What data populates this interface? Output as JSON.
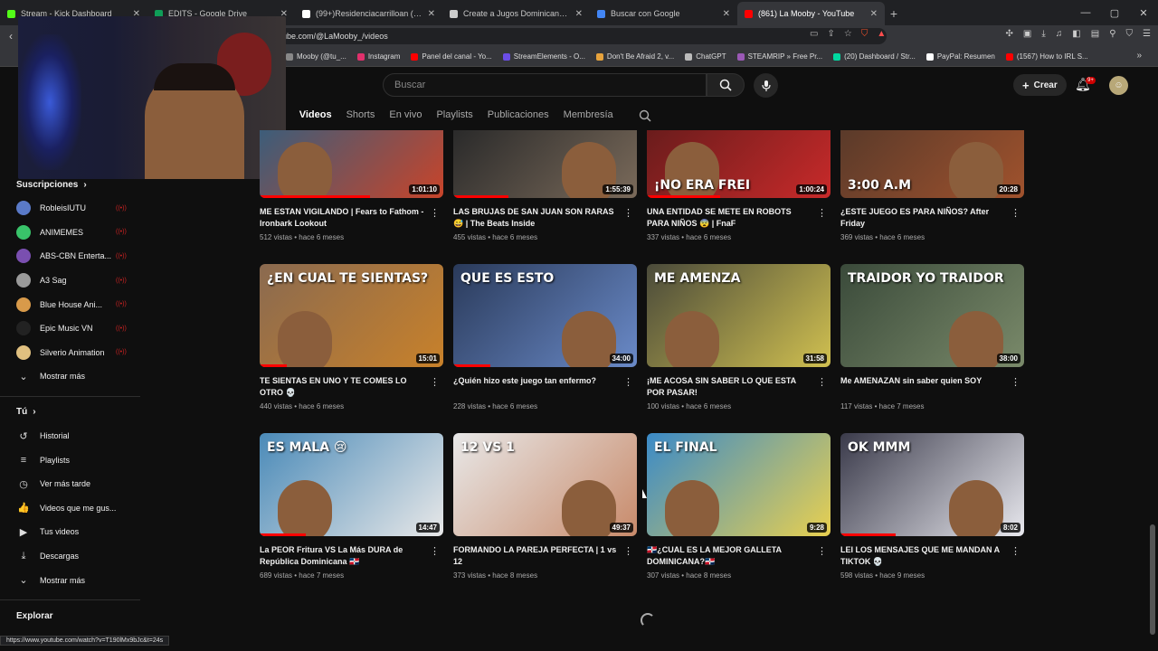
{
  "browser": {
    "tabs": [
      {
        "label": "Stream - Kick Dashboard",
        "color": "#53fc18"
      },
      {
        "label": "EDITS - Google Drive",
        "color": "#0f9d58"
      },
      {
        "label": "(99+)Residenciacarrilloan (@residenc",
        "color": "#ffffff"
      },
      {
        "label": "Create a Jugos Dominicanos Tier List",
        "color": "#cccccc"
      },
      {
        "label": "Buscar con Google",
        "color": "#4285f4"
      },
      {
        "label": "(861) La Mooby - YouTube",
        "color": "#ff0000",
        "active": true
      }
    ],
    "new_tab": "+",
    "address": "ube.com/@LaMooby_/videos",
    "bookmarks": [
      {
        "label": "Mooby (@tu_...",
        "color": "#888888"
      },
      {
        "label": "Instagram",
        "color": "#e1306c"
      },
      {
        "label": "Panel del canal - Yo...",
        "color": "#ff0000"
      },
      {
        "label": "StreamElements - O...",
        "color": "#6b4de6"
      },
      {
        "label": "Don't Be Afraid 2, v...",
        "color": "#e6a23c"
      },
      {
        "label": "ChatGPT",
        "color": "#bbbbbb"
      },
      {
        "label": "STEAMRIP » Free Pr...",
        "color": "#9b59b6"
      },
      {
        "label": "(20) Dashboard / Str...",
        "color": "#00d8a0"
      },
      {
        "label": "PayPal: Resumen",
        "color": "#ffffff"
      },
      {
        "label": "(1567) How to IRL S...",
        "color": "#ff0000"
      }
    ],
    "status_url": "https://www.youtube.com/watch?v=T190lMx9bJc&t=24s"
  },
  "youtube": {
    "search_placeholder": "Buscar",
    "create_label": "Crear",
    "notifications": "9+",
    "channel_tabs": [
      {
        "label": "pal",
        "active": false
      },
      {
        "label": "Videos",
        "active": true
      },
      {
        "label": "Shorts",
        "active": false
      },
      {
        "label": "En vivo",
        "active": false
      },
      {
        "label": "Playlists",
        "active": false
      },
      {
        "label": "Publicaciones",
        "active": false
      },
      {
        "label": "Membresía",
        "active": false
      }
    ]
  },
  "sidebar": {
    "subscriptions_title": "Suscripciones",
    "subscriptions": [
      {
        "label": "RobleisIUTU",
        "color": "#5a7ac8"
      },
      {
        "label": "ANIMEMES",
        "color": "#39c36a"
      },
      {
        "label": "ABS-CBN Enterta...",
        "color": "#7a4fb0"
      },
      {
        "label": "A3 Sag",
        "color": "#9a9a9a"
      },
      {
        "label": "Blue House Ani...",
        "color": "#d89a4a"
      },
      {
        "label": "Epic Music VN",
        "color": "#222222"
      },
      {
        "label": "Silverio Animation",
        "color": "#e0c080"
      }
    ],
    "show_more_1": "Mostrar más",
    "you_title": "Tú",
    "you_items": [
      {
        "label": "Historial",
        "icon": "history-icon",
        "glyph": "↺"
      },
      {
        "label": "Playlists",
        "icon": "playlist-icon",
        "glyph": "≡"
      },
      {
        "label": "Ver más tarde",
        "icon": "clock-icon",
        "glyph": "◷"
      },
      {
        "label": "Videos que me gus...",
        "icon": "thumb-up-icon",
        "glyph": "👍"
      },
      {
        "label": "Tus videos",
        "icon": "your-videos-icon",
        "glyph": "▶"
      },
      {
        "label": "Descargas",
        "icon": "download-icon",
        "glyph": "⤓"
      }
    ],
    "show_more_2": "Mostrar más",
    "explore_title": "Explorar"
  },
  "videos": [
    {
      "title": "ME ESTAN VIGILANDO | Fears to Fathom - Ironbark Lookout",
      "meta": "512 vistas • hace 6 meses",
      "duration": "1:01:10",
      "bg": "#3c5d7a",
      "accent": "#c8442a",
      "progress": 0.6
    },
    {
      "title": "LAS BRUJAS DE SAN JUAN SON RARAS 😅 | The Beats Inside",
      "meta": "455 vistas • hace 6 meses",
      "duration": "1:55:39",
      "bg": "#2a2a2a",
      "accent": "#7a6a5a",
      "progress": 0.3
    },
    {
      "title": "UNA ENTIDAD SE METE EN ROBOTS PARA NIÑOS 😨 | FnaF",
      "meta": "337 vistas • hace 6 meses",
      "duration": "1:00:24",
      "bg": "#6a1c1c",
      "accent": "#c82a2a",
      "progress": 0.4,
      "overlay": "¡NO ERA FREI"
    },
    {
      "title": "¿ESTE JUEGO ES PARA NIÑOS? After Friday",
      "meta": "369 vistas • hace 6 meses",
      "duration": "20:28",
      "bg": "#5a3a2a",
      "accent": "#a0522d",
      "progress": 0,
      "overlay": "3:00 A.M"
    },
    {
      "title": "TE SIENTAS EN UNO Y TE COMES LO OTRO 💀",
      "meta": "440 vistas • hace 6 meses",
      "duration": "15:01",
      "bg": "#8a6a50",
      "accent": "#c8812a",
      "progress": 0.15,
      "overlay": "¿EN CUAL TE SIENTAS?"
    },
    {
      "title": "¿Quién hizo este juego tan enfermo?",
      "meta": "228 vistas • hace 6 meses",
      "duration": "34:00",
      "bg": "#2a3a5a",
      "accent": "#6a8ac8",
      "progress": 0.2,
      "overlay": "QUE ES ESTO"
    },
    {
      "title": "¡ME ACOSA SIN SABER LO QUE ESTA POR PASAR!",
      "meta": "100 vistas • hace 6 meses",
      "duration": "31:58",
      "bg": "#4a4a3a",
      "accent": "#d0c050",
      "progress": 0,
      "overlay": "ME AMENZA"
    },
    {
      "title": "Me AMENAZAN sin saber quien SOY",
      "meta": "117 vistas • hace 7 meses",
      "duration": "38:00",
      "bg": "#3a4a3a",
      "accent": "#7a8a6a",
      "progress": 0,
      "overlay": "TRAIDOR  YO  TRAIDOR"
    },
    {
      "title": "La PEOR Fritura VS La Más DURA de República Dominicana 🇩🇴",
      "meta": "689 vistas • hace 7 meses",
      "duration": "14:47",
      "bg": "#4a8ab8",
      "accent": "#e8e8e8",
      "progress": 0.25,
      "overlay": "ES MALA 😢"
    },
    {
      "title": "FORMANDO LA PAREJA PERFECTA | 1 vs 12",
      "meta": "373 vistas • hace 8 meses",
      "duration": "49:37",
      "bg": "#e8e8e8",
      "accent": "#c88a6a",
      "progress": 0,
      "overlay": "12 VS 1"
    },
    {
      "title": "🇩🇴¿CUAL ES LA MEJOR GALLETA DOMINICANA?🇩🇴",
      "meta": "307 vistas • hace 8 meses",
      "duration": "9:28",
      "bg": "#3a8ac8",
      "accent": "#e8d050",
      "progress": 0,
      "overlay": "EL FINAL"
    },
    {
      "title": "LEI LOS MENSAJES QUE ME MANDAN A TIKTOK 💀",
      "meta": "598 vistas • hace 9 meses",
      "duration": "8:02",
      "bg": "#3a3a4a",
      "accent": "#e8e8ee",
      "progress": 0.3,
      "overlay": "OK MMM"
    }
  ]
}
